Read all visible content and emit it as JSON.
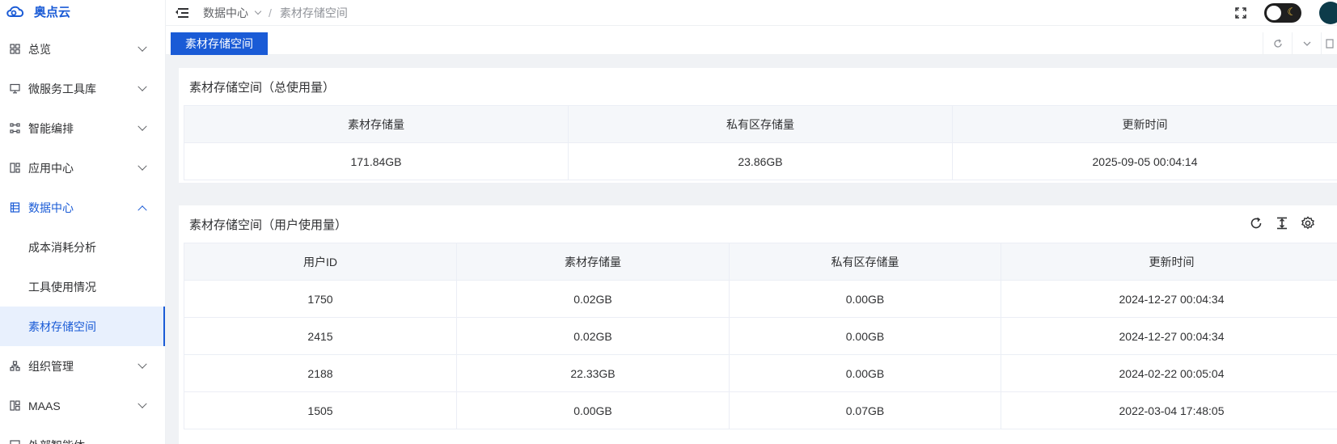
{
  "app": {
    "name": "奥点云",
    "brand_color": "#1a5bd6"
  },
  "sidebar": {
    "items": [
      {
        "label": "总览",
        "icon": "grid-icon"
      },
      {
        "label": "微服务工具库",
        "icon": "monitor-icon"
      },
      {
        "label": "智能编排",
        "icon": "workflow-icon"
      },
      {
        "label": "应用中心",
        "icon": "apps-icon"
      },
      {
        "label": "数据中心",
        "icon": "data-icon",
        "open": true
      },
      {
        "label": "组织管理",
        "icon": "org-icon"
      },
      {
        "label": "MAAS",
        "icon": "maas-icon"
      },
      {
        "label": "外部智能体",
        "icon": "agent-icon"
      }
    ],
    "sub_items": [
      {
        "label": "成本消耗分析"
      },
      {
        "label": "工具使用情况"
      },
      {
        "label": "素材存储空间",
        "selected": true
      }
    ]
  },
  "header": {
    "breadcrumb": [
      "数据中心",
      "素材存储空间"
    ]
  },
  "tabs": {
    "active_label": "素材存储空间"
  },
  "total_card": {
    "title": "素材存储空间（总使用量）",
    "columns": [
      "素材存储量",
      "私有区存储量",
      "更新时间"
    ],
    "row": [
      "171.84GB",
      "23.86GB",
      "2025-09-05 00:04:14"
    ]
  },
  "user_card": {
    "title": "素材存储空间（用户使用量）",
    "columns": [
      "用户ID",
      "素材存储量",
      "私有区存储量",
      "更新时间"
    ],
    "rows": [
      [
        "1750",
        "0.02GB",
        "0.00GB",
        "2024-12-27 00:04:34"
      ],
      [
        "2415",
        "0.02GB",
        "0.00GB",
        "2024-12-27 00:04:34"
      ],
      [
        "2188",
        "22.33GB",
        "0.00GB",
        "2024-02-22 00:05:04"
      ],
      [
        "1505",
        "0.00GB",
        "0.07GB",
        "2022-03-04 17:48:05"
      ]
    ]
  }
}
